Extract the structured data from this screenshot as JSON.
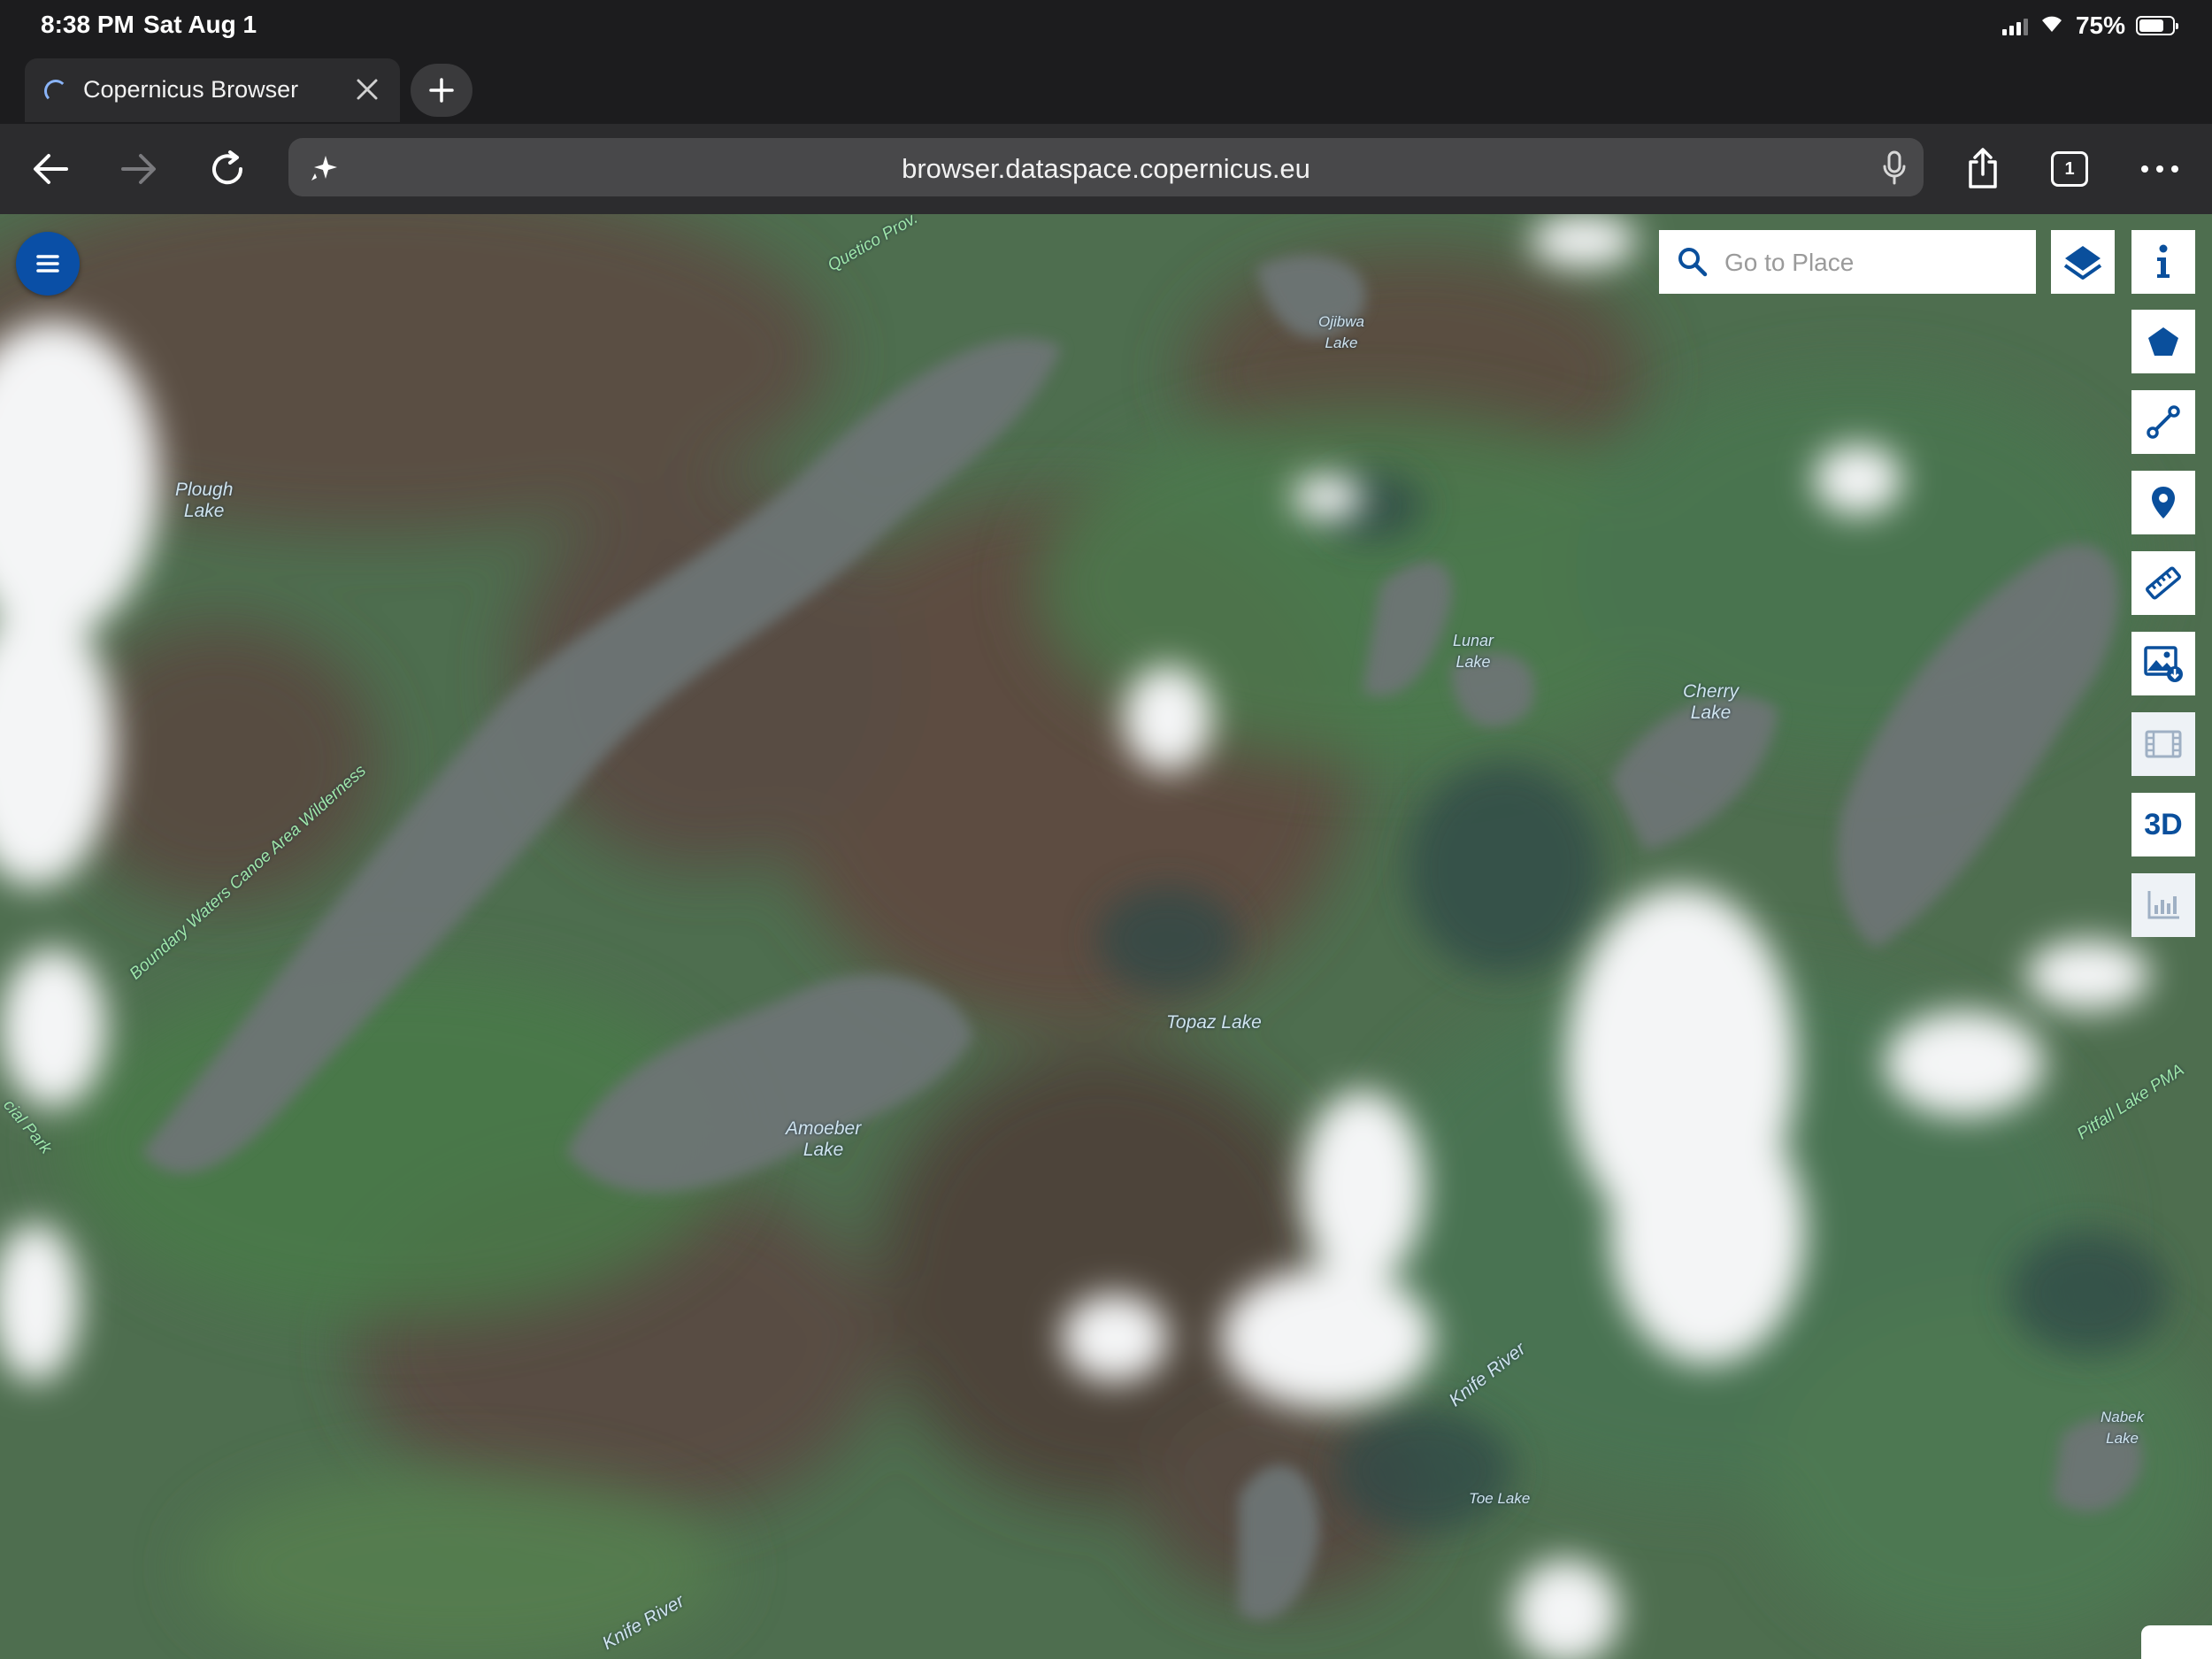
{
  "status_bar": {
    "time": "8:38 PM",
    "date": "Sat Aug 1",
    "battery_percent": "75%",
    "battery_level": 0.75
  },
  "browser": {
    "tab_title": "Copernicus Browser",
    "url": "browser.dataspace.copernicus.eu",
    "tab_count": "1",
    "icons": [
      "back-icon",
      "forward-icon",
      "reload-icon",
      "sparkle-icon",
      "mic-icon",
      "share-icon",
      "tabs-icon",
      "more-icon",
      "close-icon",
      "plus-icon"
    ]
  },
  "map": {
    "search": {
      "placeholder": "Go to Place",
      "value": ""
    },
    "labels": {
      "plough_lake": "Plough\nLake",
      "ojibwa_lake": "Ojibwa\nLake",
      "lunar_lake": "Lunar\nLake",
      "cherry_lake": "Cherry\nLake",
      "topaz_lake": "Topaz Lake",
      "amoeber_lake": "Amoeber\nLake",
      "knife_river_1": "Knife River",
      "knife_river_2": "Knife River",
      "toe_lake": "Toe Lake",
      "nabek_lake": "Nabek\nLake",
      "quetico_park": "Quetico Prov.",
      "bwcaw": "Boundary Waters Canoe Area Wilderness",
      "pitfall_lake_pma": "Pitfall Lake PMA",
      "provincial_park": "cial Park"
    },
    "tools": [
      "info-icon",
      "polygon-icon",
      "line-icon",
      "pin-icon",
      "ruler-icon",
      "image-download-icon",
      "film-icon",
      "3d",
      "chart-icon"
    ],
    "tool_3d_label": "3D"
  }
}
